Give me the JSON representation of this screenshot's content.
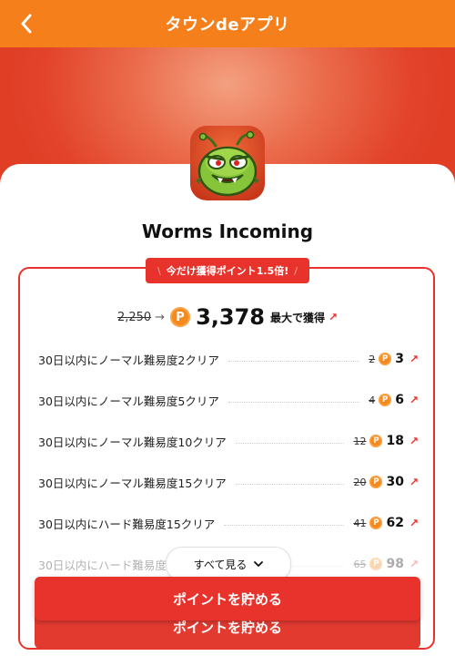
{
  "header": {
    "title": "タウンdeアプリ"
  },
  "app": {
    "name": "Worms Incoming"
  },
  "bonus": {
    "text": "今だけ獲得ポイント1.5倍!"
  },
  "total": {
    "old": "2,250",
    "arrow": "→",
    "coin": "P",
    "value": "3,378",
    "suffix": "最大で獲得"
  },
  "tasks": [
    {
      "label": "30日以内にノーマル難易度2クリア",
      "old": "2",
      "new": "3"
    },
    {
      "label": "30日以内にノーマル難易度5クリア",
      "old": "4",
      "new": "6"
    },
    {
      "label": "30日以内にノーマル難易度10クリア",
      "old": "12",
      "new": "18"
    },
    {
      "label": "30日以内にノーマル難易度15クリア",
      "old": "20",
      "new": "30"
    },
    {
      "label": "30日以内にハード難易度15クリア",
      "old": "41",
      "new": "62"
    },
    {
      "label": "30日以内にハード難易度2",
      "old": "65",
      "new": "98"
    }
  ],
  "see_all": {
    "label": "すべて見る"
  },
  "cta": {
    "label": "ポイントを貯める"
  },
  "colors": {
    "header": "#f47f1b",
    "accent": "#e8322c",
    "coin": "#f5891e"
  }
}
